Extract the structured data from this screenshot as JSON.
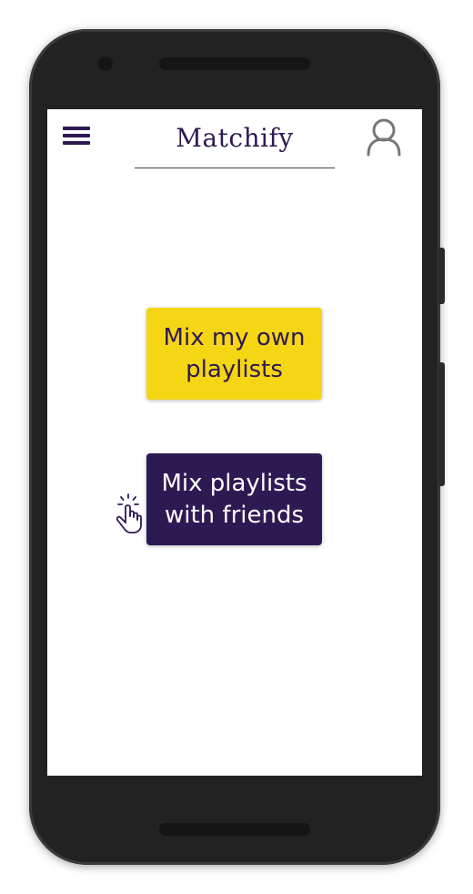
{
  "app": {
    "title": "Matchify"
  },
  "header": {
    "menu_icon": "hamburger-menu-icon",
    "account_icon": "user-profile-icon"
  },
  "actions": {
    "mix_own": "Mix my own playlists",
    "mix_friends": "Mix playlists with friends"
  },
  "hint_icon": "tap-gesture-icon",
  "colors": {
    "brand_purple": "#2e1a53",
    "accent_yellow": "#f5d614",
    "device_body": "#222222",
    "screen_background": "#ffffff"
  }
}
